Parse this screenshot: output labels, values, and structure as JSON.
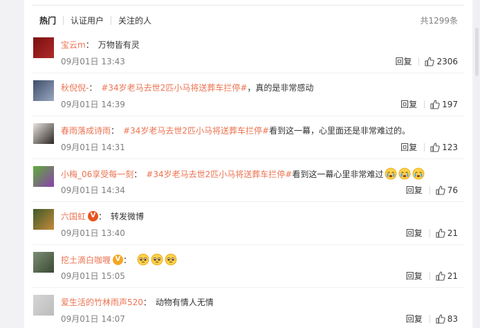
{
  "tabs": [
    {
      "label": "热门",
      "active": true
    },
    {
      "label": "认证用户",
      "active": false
    },
    {
      "label": "关注的人",
      "active": false
    }
  ],
  "total_count": "共1299条",
  "comments": [
    {
      "user": "宝云m",
      "topic": "",
      "content": "万物皆有灵",
      "time": "09月01日 13:43",
      "reply_label": "回复",
      "likes": "2306",
      "avatar_colors": [
        "#7a1010",
        "#b02a2a"
      ],
      "badge": null,
      "emojis": []
    },
    {
      "user": "秋倪倪-",
      "topic": "#34岁老马去世2匹小马将送葬车拦停#",
      "content": "，真的是非常感动",
      "time": "09月01日 14:39",
      "reply_label": "回复",
      "likes": "197",
      "avatar_colors": [
        "#3d4d6a",
        "#9aa8c0"
      ],
      "badge": null,
      "emojis": []
    },
    {
      "user": "春雨落成诗雨",
      "topic": "#34岁老马去世2匹小马将送葬车拦停#",
      "content": "看到这一幕，心里面还是非常难过的。",
      "time": "09月01日 14:31",
      "reply_label": "回复",
      "likes": "123",
      "avatar_colors": [
        "#e9e4e0",
        "#2b2523"
      ],
      "badge": null,
      "emojis": []
    },
    {
      "user": "小梅_06享受每一刻",
      "topic": "#34岁老马去世2匹小马将送葬车拦停#",
      "content": " 看到这一幕心里非常难过",
      "time": "09月01日 14:34",
      "reply_label": "回复",
      "likes": "76",
      "avatar_colors": [
        "#5fae3a",
        "#8a3fae"
      ],
      "badge": null,
      "emojis": [
        "crying-emoji",
        "crying-emoji",
        "crying-emoji"
      ]
    },
    {
      "user": "六国虹",
      "topic": "",
      "content": "转发微博",
      "time": "09月01日 13:40",
      "reply_label": "回复",
      "likes": "21",
      "avatar_colors": [
        "#3f5a2a",
        "#c48a3a"
      ],
      "badge": "red",
      "emojis": []
    },
    {
      "user": "挖土滴白咖喱",
      "topic": "",
      "content": "",
      "time": "09月01日 15:05",
      "reply_label": "回复",
      "likes": "21",
      "avatar_colors": [
        "#7b8e74",
        "#3a4a34"
      ],
      "badge": "yellow",
      "emojis": [
        "pleading-emoji",
        "pleading-emoji",
        "pleading-emoji"
      ]
    },
    {
      "user": "爱生活的竹林雨声520",
      "topic": "",
      "content": "动物有情人无情",
      "time": "09月01日 14:07",
      "reply_label": "回复",
      "likes": "83",
      "avatar_colors": [
        "#d6d6d6",
        "#bcbcbc"
      ],
      "badge": null,
      "emojis": []
    }
  ]
}
